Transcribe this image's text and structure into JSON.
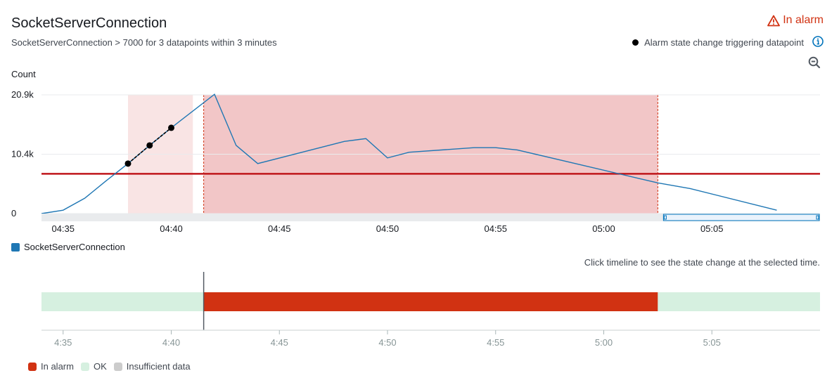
{
  "header": {
    "title": "SocketServerConnection",
    "subtitle": "SocketServerConnection > 7000 for 3 datapoints within 3 minutes",
    "state": "In alarm",
    "trigger_legend": "Alarm state change triggering datapoint"
  },
  "icons": {
    "state": "warning-icon",
    "info": "info-icon",
    "zoom": "zoom-out-icon"
  },
  "colors": {
    "line": "#1f77b4",
    "threshold": "#c0161b",
    "alarm_fill": "#f2c6c7",
    "alarm_light": "#f9e4e4",
    "alarm_state": "#d13212",
    "ok_state": "#d6f0e0",
    "insufficient_state": "#cccccc"
  },
  "chart": {
    "unit_label": "Count",
    "y_ticks": [
      "20.9k",
      "10.4k",
      "0"
    ],
    "x_ticks": [
      "04:35",
      "04:40",
      "04:45",
      "04:50",
      "04:55",
      "05:00",
      "05:05"
    ]
  },
  "chart_data": {
    "type": "line",
    "ylabel": "Count",
    "ylim": [
      0,
      20900
    ],
    "xlim": [
      "04:34",
      "05:10"
    ],
    "x": [
      "04:34",
      "04:35",
      "04:36",
      "04:37",
      "04:38",
      "04:39",
      "04:40",
      "04:42",
      "04:43",
      "04:44",
      "04:48",
      "04:49",
      "04:50",
      "04:51",
      "04:54",
      "04:55",
      "04:56",
      "05:02.5",
      "05:04",
      "05:08"
    ],
    "series": [
      {
        "name": "SocketServerConnection",
        "values": [
          0,
          600,
          2700,
          5800,
          8800,
          12000,
          15100,
          21000,
          12000,
          8800,
          12700,
          13200,
          9800,
          10800,
          11600,
          11600,
          11200,
          5400,
          4400,
          600
        ]
      }
    ],
    "threshold": 7000,
    "triggering_datapoints": [
      {
        "x": "04:38",
        "y": 8800
      },
      {
        "x": "04:39",
        "y": 12000
      },
      {
        "x": "04:40",
        "y": 15100
      }
    ],
    "alarm_period": {
      "start": "04:41.5",
      "end": "05:02.5"
    },
    "pending_period": {
      "start": "04:38",
      "end": "04:41"
    }
  },
  "legend": {
    "series_label": "SocketServerConnection"
  },
  "timeline": {
    "hint": "Click timeline to see the state change at the selected time.",
    "x_ticks": [
      "4:35",
      "4:40",
      "4:45",
      "4:50",
      "4:55",
      "5:00",
      "5:05"
    ],
    "segments": [
      {
        "state": "OK",
        "start": "04:34",
        "end": "04:41.5"
      },
      {
        "state": "In alarm",
        "start": "04:41.5",
        "end": "05:02.5"
      },
      {
        "state": "OK",
        "start": "05:02.5",
        "end": "05:10"
      }
    ],
    "legend": [
      {
        "label": "In alarm",
        "state": "alarm"
      },
      {
        "label": "OK",
        "state": "ok"
      },
      {
        "label": "Insufficient data",
        "state": "insufficient"
      }
    ]
  }
}
